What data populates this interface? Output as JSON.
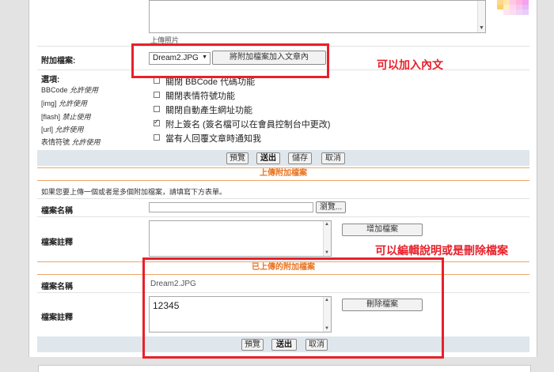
{
  "editor": {
    "status_label": "上傳照片"
  },
  "attach": {
    "label": "附加檔案:",
    "selected_file": "Dream2.JPG",
    "insert_button": "將附加檔案加入文章內"
  },
  "options": {
    "label": "選項:",
    "side_items": [
      {
        "name": "BBCode",
        "status": "允許使用"
      },
      {
        "name": "[img]",
        "status": "允許使用"
      },
      {
        "name": "[flash]",
        "status": "禁止使用"
      },
      {
        "name": "[url]",
        "status": "允許使用"
      },
      {
        "name": "表情符號",
        "status": "允許使用"
      }
    ],
    "checkboxes": [
      {
        "label": "關閉 BBCode 代碼功能",
        "checked": false
      },
      {
        "label": "關閉表情符號功能",
        "checked": false
      },
      {
        "label": "關閉自動產生網址功能",
        "checked": false
      },
      {
        "label": "附上簽名 (簽名檔可以在會員控制台中更改)",
        "checked": true
      },
      {
        "label": "當有人回覆文章時通知我",
        "checked": false
      }
    ]
  },
  "actions_top": {
    "preview": "預覽",
    "submit": "送出",
    "save": "儲存",
    "cancel": "取消"
  },
  "upload_section": {
    "title": "上傳附加檔案",
    "instructions": "如果您要上傳一個或者是多個附加檔案，請填寫下方表單。",
    "filename_label": "檔案名稱",
    "browse_button": "瀏覽...",
    "comment_label": "檔案註釋",
    "add_button": "增加檔案"
  },
  "uploaded_section": {
    "title": "已上傳的附加檔案",
    "filename_label": "檔案名稱",
    "filename_value": "Dream2.JPG",
    "comment_label": "檔案註釋",
    "comment_value": "12345",
    "delete_button": "刪除檔案"
  },
  "actions_bottom": {
    "preview": "預覽",
    "submit": "送出",
    "cancel": "取消"
  },
  "annotations": {
    "insert_note": "可以加入內文",
    "edit_note": "可以編輯說明或是刪除檔案"
  },
  "colors": {
    "annotation_red": "#e8202a",
    "section_title_orange": "#e8731f"
  }
}
